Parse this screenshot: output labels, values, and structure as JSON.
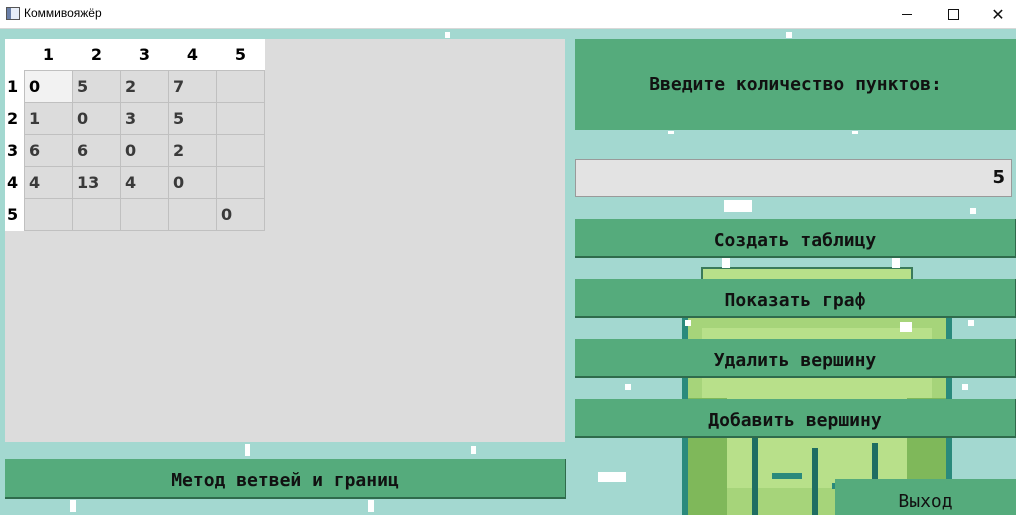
{
  "window": {
    "title": "Коммивояжёр",
    "minimize": "–",
    "maximize": "□",
    "close": "✕"
  },
  "table": {
    "column_headers": [
      "1",
      "2",
      "3",
      "4",
      "5"
    ],
    "rows": [
      {
        "header": "1",
        "cells": [
          "0",
          "5",
          "2",
          "7",
          ""
        ]
      },
      {
        "header": "2",
        "cells": [
          "1",
          "0",
          "3",
          "5",
          ""
        ]
      },
      {
        "header": "3",
        "cells": [
          "6",
          "6",
          "0",
          "2",
          ""
        ]
      },
      {
        "header": "4",
        "cells": [
          "4",
          "13",
          "4",
          "0",
          ""
        ]
      },
      {
        "header": "5",
        "cells": [
          "",
          "",
          "",
          "",
          "0"
        ]
      }
    ]
  },
  "right_panel": {
    "prompt": "Введите количество пунктов:",
    "count_value": "5",
    "create_table": "Создать таблицу",
    "show_graph": "Показать граф",
    "delete_vertex": "Удалить вершину",
    "add_vertex": "Добавить вершину"
  },
  "bottom": {
    "method_button": "Метод ветвей и границ",
    "exit_button": "Выход"
  },
  "colors": {
    "background": "#a3d8d0",
    "button": "#55ab7c",
    "table_bg": "#dcdcdc"
  }
}
